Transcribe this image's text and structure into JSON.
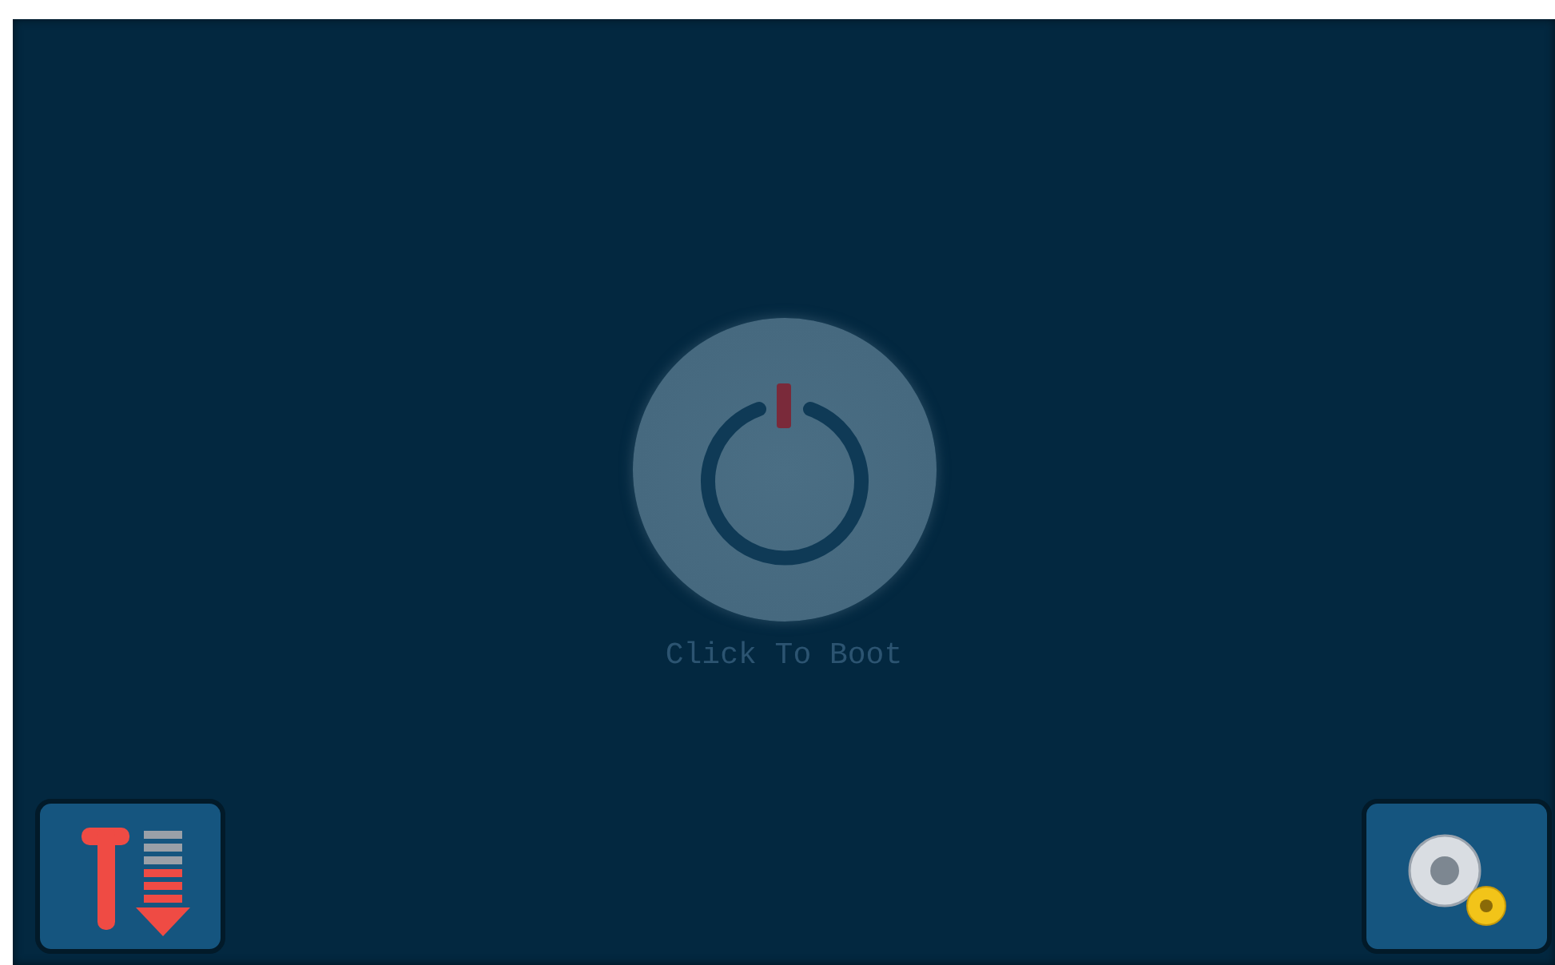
{
  "power_button": {
    "label": "Click To Boot"
  }
}
